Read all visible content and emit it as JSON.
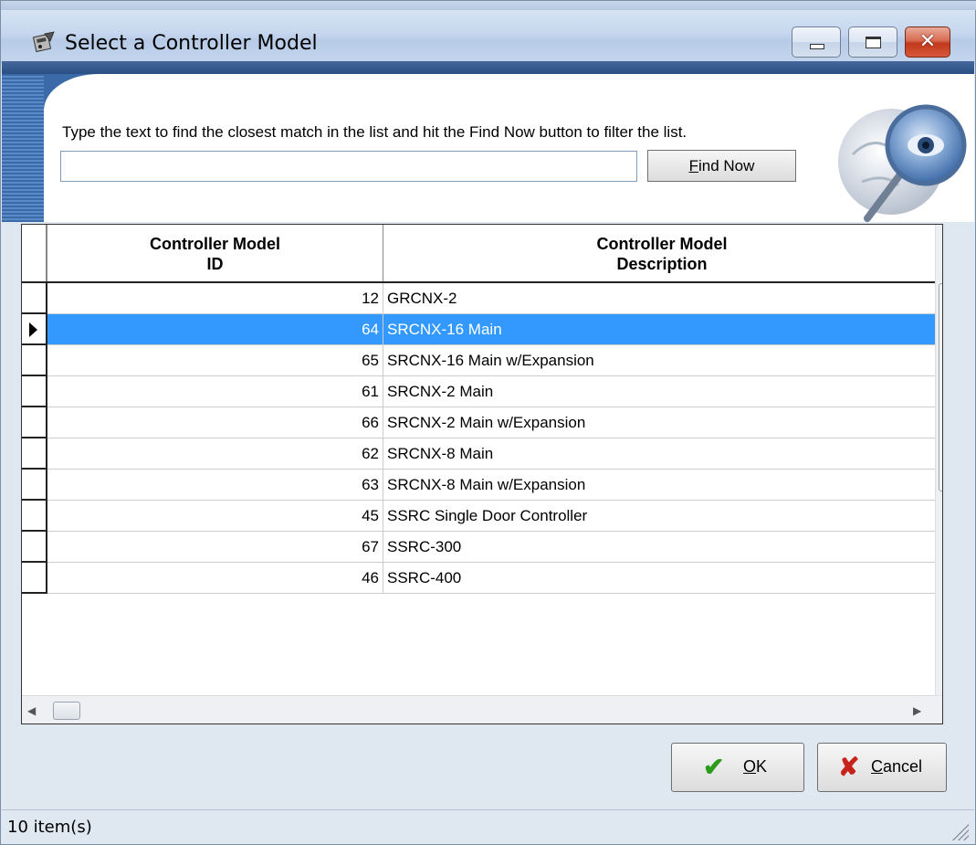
{
  "window": {
    "title": "Select a Controller Model",
    "icon": "controller-app-icon"
  },
  "search": {
    "instruction": "Type the text to find the closest match in the list and hit the Find Now button to filter the list.",
    "value": "",
    "placeholder": "",
    "find_button": {
      "access_key": "F",
      "rest": "ind Now"
    }
  },
  "grid": {
    "columns": [
      {
        "line1": "Controller Model",
        "line2": "ID"
      },
      {
        "line1": "Controller Model",
        "line2": "Description"
      }
    ],
    "rows": [
      {
        "id": "12",
        "description": "GRCNX-2"
      },
      {
        "id": "64",
        "description": "SRCNX-16 Main"
      },
      {
        "id": "65",
        "description": "SRCNX-16 Main w/Expansion"
      },
      {
        "id": "61",
        "description": "SRCNX-2 Main"
      },
      {
        "id": "66",
        "description": "SRCNX-2 Main w/Expansion"
      },
      {
        "id": "62",
        "description": "SRCNX-8 Main"
      },
      {
        "id": "63",
        "description": "SRCNX-8 Main w/Expansion"
      },
      {
        "id": "45",
        "description": "SSRC Single Door Controller"
      },
      {
        "id": "67",
        "description": "SSRC-300"
      },
      {
        "id": "46",
        "description": "SSRC-400"
      }
    ],
    "selected_index": 1
  },
  "buttons": {
    "ok": {
      "access_key": "O",
      "rest": "K",
      "icon": "checkmark-icon"
    },
    "cancel": {
      "access_key": "C",
      "rest": "ancel",
      "icon": "x-icon"
    }
  },
  "status": {
    "text": "10 item(s)"
  },
  "colors": {
    "selection": "#3399ff",
    "title_band": "#2b4f85",
    "ok_check": "#2e9b1d",
    "cancel_x": "#c8231a"
  }
}
